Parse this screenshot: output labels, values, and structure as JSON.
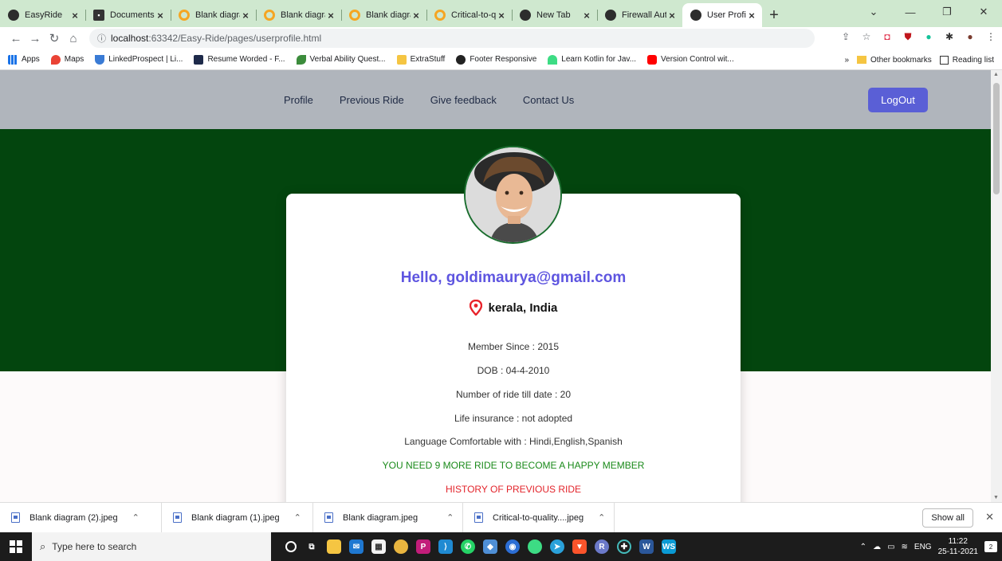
{
  "browser": {
    "tabs": [
      {
        "title": "EasyRide",
        "icon": "globe-icon"
      },
      {
        "title": "Documents",
        "icon": "document-icon"
      },
      {
        "title": "Blank diagram",
        "icon": "diagram-icon"
      },
      {
        "title": "Blank diagram",
        "icon": "diagram-icon"
      },
      {
        "title": "Blank diagram",
        "icon": "diagram-icon"
      },
      {
        "title": "Critical-to-qua",
        "icon": "diagram-icon"
      },
      {
        "title": "New Tab",
        "icon": "globe-icon"
      },
      {
        "title": "Firewall Authe",
        "icon": "globe-icon"
      },
      {
        "title": "User Profile",
        "icon": "globe-icon",
        "active": true
      }
    ],
    "url_host": "localhost",
    "url_path": ":63342/Easy-Ride/pages/userprofile.html",
    "bookmarks": [
      "Apps",
      "Maps",
      "LinkedProspect | Li...",
      "Resume Worded - F...",
      "Verbal Ability Quest...",
      "ExtraStuff",
      "Footer Responsive",
      "Learn Kotlin for Jav...",
      "Version Control wit..."
    ],
    "bookmarks_right": [
      "»",
      "Other bookmarks",
      "Reading list"
    ]
  },
  "site": {
    "nav": [
      "Profile",
      "Previous Ride",
      "Give feedback",
      "Contact Us"
    ],
    "logout_label": "LogOut",
    "colors": {
      "nav_bg": "#b0b5bc",
      "hero_bg": "#03450e",
      "accent": "#5a5fd6",
      "greeting": "#5e55e0",
      "happy": "#1a8a1a",
      "history": "#e3242b"
    }
  },
  "profile": {
    "greeting": "Hello, goldimaurya@gmail.com",
    "location": "kerala, India",
    "member_since": "Member Since : 2015",
    "dob": "DOB : 04-4-2010",
    "rides": "Number of ride till date : 20",
    "insurance": "Life insurance : not adopted",
    "languages": "Language Comfortable with : Hindi,English,Spanish",
    "happy_member": "YOU NEED 9 MORE RIDE TO BECOME A HAPPY MEMBER",
    "history": "HISTORY OF PREVIOUS RIDE"
  },
  "downloads": {
    "files": [
      "Blank diagram (2).jpeg",
      "Blank diagram (1).jpeg",
      "Blank diagram.jpeg",
      "Critical-to-quality....jpeg"
    ],
    "show_all": "Show all"
  },
  "taskbar": {
    "search_placeholder": "Type here to search",
    "time": "11:22",
    "date": "25-11-2021",
    "lang": "ENG"
  }
}
